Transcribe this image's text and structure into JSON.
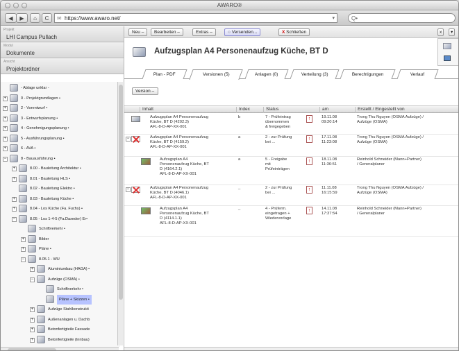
{
  "window": {
    "title": "AWARO®"
  },
  "browser": {
    "back": "◀",
    "forward": "▶",
    "home": "⌂",
    "reload": "C",
    "url": "https://www.awaro.net/",
    "search_placeholder": "Q•"
  },
  "sidebar": {
    "project_label": "Projekt",
    "project_value": "LHI Campus Pullach",
    "module_label": "Modul",
    "module_value": "Dokumente",
    "view_label": "Ansicht",
    "view_value": "Projektordner",
    "tree": [
      {
        "label": "- Ablage unklar -",
        "level": 0,
        "toggle": ""
      },
      {
        "label": "0 - Projektgrundlagen •",
        "level": 0,
        "toggle": "+"
      },
      {
        "label": "2 - Vorentwurf •",
        "level": 0,
        "toggle": "+"
      },
      {
        "label": "3 - Entwurfsplanung •",
        "level": 0,
        "toggle": "+"
      },
      {
        "label": "4 - Genehmigungsplanung •",
        "level": 0,
        "toggle": "+"
      },
      {
        "label": "5 - Ausführungsplanung •",
        "level": 0,
        "toggle": "+"
      },
      {
        "label": "6 - AVA •",
        "level": 0,
        "toggle": "+"
      },
      {
        "label": "8 - Bauausführung •",
        "level": 0,
        "toggle": "−"
      },
      {
        "label": "8.00 - Bauleitung Architektur •",
        "level": 1,
        "toggle": "+"
      },
      {
        "label": "8.01 - Bauleitung HLS •",
        "level": 1,
        "toggle": "+"
      },
      {
        "label": "8.02 - Bauleitung Elektro •",
        "level": 1,
        "toggle": ""
      },
      {
        "label": "8.03 - Bauleitung Küche •",
        "level": 1,
        "toggle": "+"
      },
      {
        "label": "8.04 - Los Küche (Fa. Fuchs) •",
        "level": 1,
        "toggle": "+"
      },
      {
        "label": "8.05 - Los 1-4-5 (Fa.Daxeder) Er•",
        "level": 1,
        "toggle": "−"
      },
      {
        "label": "Schriftverkehr •",
        "level": 2,
        "toggle": ""
      },
      {
        "label": "Bilder",
        "level": 2,
        "toggle": "+"
      },
      {
        "label": "Pläne •",
        "level": 2,
        "toggle": "+"
      },
      {
        "label": "8.05.1 - WU",
        "level": 2,
        "toggle": "−"
      },
      {
        "label": "Aluminiumbau (HAGA) •",
        "level": 3,
        "toggle": "+"
      },
      {
        "label": "Aufzüge (OSMA) •",
        "level": 3,
        "toggle": "−"
      },
      {
        "label": "Schriftverkehr •",
        "level": 4,
        "toggle": ""
      },
      {
        "label": "Pläne + Skizzen •",
        "level": 4,
        "toggle": "",
        "selected": true
      },
      {
        "label": "Aufzüge Stahlkonstrukti",
        "level": 3,
        "toggle": "+"
      },
      {
        "label": "Außenanlagen u. Dachb",
        "level": 3,
        "toggle": "+"
      },
      {
        "label": "Betonfertigteile Fassade",
        "level": 3,
        "toggle": "+"
      },
      {
        "label": "Betonfertigteile (Innbau)",
        "level": 3,
        "toggle": "+"
      }
    ],
    "hscroll_label": "III"
  },
  "toolbar": {
    "new": "Neu –",
    "edit": "Bearbeiten –",
    "extras": "Extras –",
    "send": "Versenden...",
    "close_x": "X",
    "close": "Schließen",
    "x_btn": "x",
    "menu_btn": "▾"
  },
  "document": {
    "title": "Aufzugsplan A4 Personenaufzug Küche, BT D"
  },
  "tabs": [
    "Plan - PDF",
    "Versionen (5)",
    "Anlagen (0)",
    "Verteilung (3)",
    "Berechtigungen",
    "Verlauf"
  ],
  "version_button": "Version –",
  "table": {
    "headers": [
      "Inhalt",
      "Index",
      "Status",
      "am",
      "Erstellt / Eingestellt von"
    ],
    "rows": [
      {
        "toggle": "",
        "icon": "plan",
        "indent": 0,
        "inhalt": [
          "Aufzugsplan A4 Personenaufzug",
          "Küche, BT D  (4202.3)",
          "AFL-8-D-AP-XX-001"
        ],
        "index": "b",
        "status": [
          "7 - Prüfeintrag",
          "übernommen",
          "& freigegeben"
        ],
        "am": [
          "19.11.08",
          "09:20:14"
        ],
        "von": [
          "Trong Thu Nguyen (OSMA Aufzüge) /",
          "Aufzüge (OSMA)"
        ]
      },
      {
        "toggle": "−",
        "icon": "red",
        "indent": 0,
        "inhalt": [
          "Aufzugsplan A4 Personenaufzug",
          "Küche, BT D  (4159.2)",
          "AFL-8-D-AP-XX-001"
        ],
        "index": "a",
        "status": [
          "2 - zur Prüfung",
          "bei ..."
        ],
        "am": [
          "17.11.08",
          "11:23:08"
        ],
        "von": [
          "Trong Thu Nguyen (OSMA Aufzüge) /",
          "Aufzüge (OSMA)"
        ]
      },
      {
        "toggle": "",
        "icon": "green",
        "indent": 1,
        "inhalt": [
          "Aufzugsplan A4",
          "Personenaufzug Küche, BT",
          "D  (4164.2.1)",
          "AFL-8-D-AP-XX-001"
        ],
        "index": "a",
        "status": [
          "5 - Freigabe",
          "mit",
          "Prüfeinträgen"
        ],
        "am": [
          "18.11.08",
          "11:36:51"
        ],
        "von": [
          "Reinhold Schneider (Mann+Partner)",
          "/ Generalplaner"
        ]
      },
      {
        "toggle": "−",
        "icon": "red",
        "indent": 0,
        "inhalt": [
          "Aufzugsplan A4 Personenaufzug",
          "Küche, BT D  (4046.1)",
          "AFL-8-D-AP-XX-001"
        ],
        "index": "_",
        "status": [
          "2 - zur Prüfung",
          "bei ..."
        ],
        "am": [
          "11.11.08",
          "16:15:59"
        ],
        "von": [
          "Trong Thu Nguyen (OSMA Aufzüge) /",
          "Aufzüge (OSMA)"
        ]
      },
      {
        "toggle": "",
        "icon": "green",
        "indent": 1,
        "inhalt": [
          "Aufzugsplan A4",
          "Personenaufzug Küche, BT",
          "D  (4114.1.1)",
          "AFL-8-D-AP-XX-001"
        ],
        "index": "_",
        "status": [
          "4 - Prüferm.",
          "eingetragen +",
          "Wiedervorlage"
        ],
        "am": [
          "14.11.08",
          "17:37:54"
        ],
        "von": [
          "Reinhold Schneider (Mann+Partner)",
          "/ Generalplaner"
        ]
      }
    ]
  }
}
